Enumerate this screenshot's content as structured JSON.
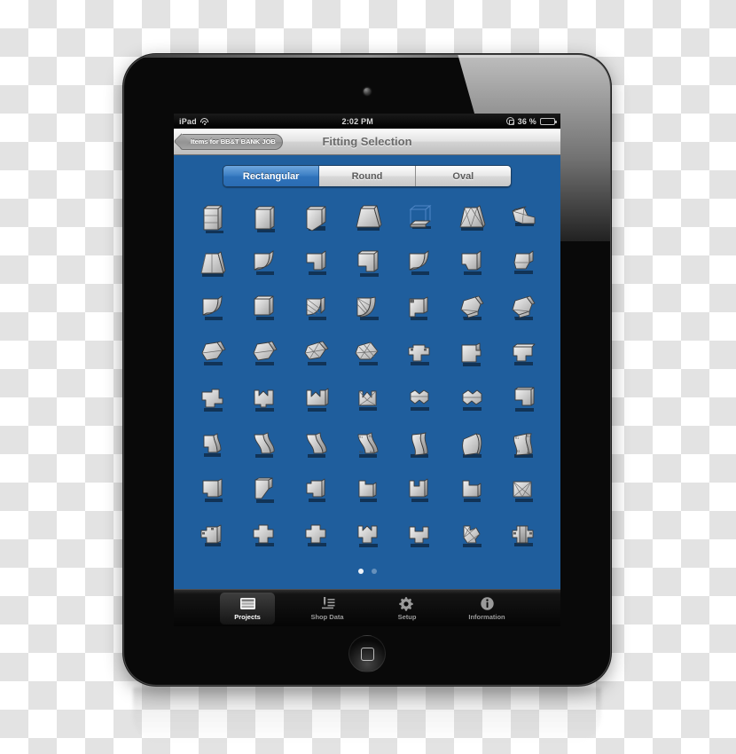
{
  "device": {
    "name": "iPad",
    "camera": "front-camera",
    "home_button": "home-button"
  },
  "status_bar": {
    "carrier_label": "iPad",
    "wifi_icon": "wifi-icon",
    "time": "2:02 PM",
    "rotation_lock_icon": "rotation-lock-icon",
    "battery_percent": "36 %",
    "battery_level": 36,
    "battery_icon": "battery-icon"
  },
  "nav_bar": {
    "back_label": "Items for BB&T BANK JOB",
    "title": "Fitting Selection"
  },
  "segmented_control": {
    "selected_index": 0,
    "options": [
      {
        "label": "Rectangular",
        "selected": true
      },
      {
        "label": "Round",
        "selected": false
      },
      {
        "label": "Oval",
        "selected": false
      }
    ]
  },
  "fitting_grid": {
    "columns": 7,
    "rows": 8,
    "count": 56,
    "items": [
      {
        "name": "straight-duct-sectioned"
      },
      {
        "name": "straight-duct"
      },
      {
        "name": "duct-with-flap"
      },
      {
        "name": "tapered-transition"
      },
      {
        "name": "wireframe-box"
      },
      {
        "name": "pyramid-transition"
      },
      {
        "name": "angled-tap-takeoff"
      },
      {
        "name": "trapezoid-transition"
      },
      {
        "name": "radius-elbow"
      },
      {
        "name": "square-throat-elbow"
      },
      {
        "name": "offset-elbow"
      },
      {
        "name": "radius-elbow-right"
      },
      {
        "name": "square-elbow"
      },
      {
        "name": "angled-offset"
      },
      {
        "name": "radius-elbow-large"
      },
      {
        "name": "square-corner-elbow"
      },
      {
        "name": "gore-elbow"
      },
      {
        "name": "segmented-radius-elbow"
      },
      {
        "name": "elbow-with-tap"
      },
      {
        "name": "angled-boot"
      },
      {
        "name": "angled-takeoff"
      },
      {
        "name": "angled-shoe"
      },
      {
        "name": "angled-shoe-alt"
      },
      {
        "name": "mitered-angle"
      },
      {
        "name": "segmented-angle"
      },
      {
        "name": "double-tap-tee"
      },
      {
        "name": "side-tee"
      },
      {
        "name": "end-cap-tee"
      },
      {
        "name": "offset-tee"
      },
      {
        "name": "double-notch-tee"
      },
      {
        "name": "v-notch-tee"
      },
      {
        "name": "gore-wye"
      },
      {
        "name": "bullhead-wye"
      },
      {
        "name": "angled-wye"
      },
      {
        "name": "corner-transition"
      },
      {
        "name": "s-offset-small"
      },
      {
        "name": "s-offset"
      },
      {
        "name": "s-offset-steep"
      },
      {
        "name": "labeled-offset"
      },
      {
        "name": "curved-offset"
      },
      {
        "name": "rolled-offset"
      },
      {
        "name": "labeled-transition"
      },
      {
        "name": "notched-square"
      },
      {
        "name": "diagonal-offset"
      },
      {
        "name": "step-notch"
      },
      {
        "name": "step-notch-alt"
      },
      {
        "name": "double-step-notch"
      },
      {
        "name": "corner-notch"
      },
      {
        "name": "x-braced-square"
      },
      {
        "name": "side-outlet-boot"
      },
      {
        "name": "cross-fitting"
      },
      {
        "name": "cross-fitting-square"
      },
      {
        "name": "multi-outlet-fitting"
      },
      {
        "name": "plenum-boot"
      },
      {
        "name": "gored-cross"
      },
      {
        "name": "four-way-cross"
      }
    ]
  },
  "page_dots": {
    "total": 2,
    "active_index": 0
  },
  "tab_bar": {
    "selected_index": 0,
    "tabs": [
      {
        "label": "Projects",
        "icon": "projects-icon",
        "selected": true
      },
      {
        "label": "Shop Data",
        "icon": "shop-data-icon",
        "selected": false
      },
      {
        "label": "Setup",
        "icon": "gear-icon",
        "selected": false
      },
      {
        "label": "Information",
        "icon": "info-icon",
        "selected": false
      }
    ]
  },
  "colors": {
    "screen_background": "#1f5e9d",
    "accent_blue": "#3c7fc4",
    "bezel": "#090909",
    "nav_bar_text": "#6a6a6a"
  }
}
